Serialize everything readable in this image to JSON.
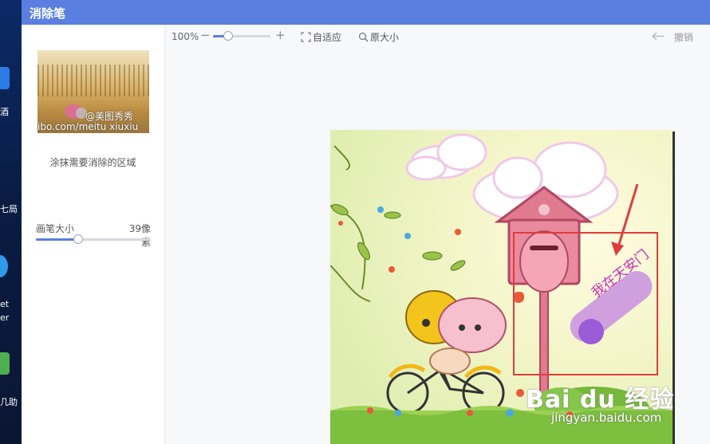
{
  "app": {
    "title": "消除笔"
  },
  "desktop": {
    "label_1": "酒",
    "label_2": "七局",
    "label_3": "et",
    "label_4": "er",
    "label_5": "几助"
  },
  "sidebar": {
    "thumbnail_watermark_1": "@美图秀秀",
    "thumbnail_watermark_2": "ibo.com/meitu xiuxiu",
    "hint": "涂抹需要消除的区域",
    "brush": {
      "label": "画笔大小",
      "value_text": "39像素",
      "level": 0.37
    }
  },
  "toolbar": {
    "zoom_text": "100%",
    "zoom_minus": "−",
    "zoom_plus": "+",
    "zoom_level": 0.27,
    "fit_label": "自适应",
    "original_label": "原大小",
    "undo_label": "撤销"
  },
  "canvas": {
    "stamp_text": "我在天安门",
    "watermark_brand": "Bai du 经验",
    "watermark_url": "jingyan.baidu.com"
  },
  "colors": {
    "accent": "#5b7fe0",
    "title_bar": "#5b7fe0",
    "annotation_red": "#e03c3c",
    "stamp_text": "#cc2bb0"
  }
}
